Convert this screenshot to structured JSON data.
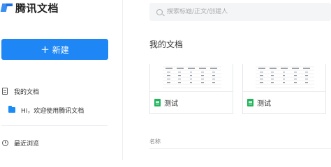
{
  "app": {
    "name": "腾讯文档"
  },
  "sidebar": {
    "new_button_label": "新建",
    "items": [
      {
        "label": "我的文档"
      },
      {
        "label": "Hi，欢迎使用腾讯文档"
      },
      {
        "label": "最近浏览"
      }
    ]
  },
  "search": {
    "placeholder": "搜索标题/正文/创建人"
  },
  "main": {
    "section_title": "我的文档",
    "cards": [
      {
        "label": "测试"
      },
      {
        "label": "测试"
      }
    ],
    "list_header": {
      "name": "名称"
    }
  },
  "colors": {
    "accent": "#1f87f5",
    "sheet": "#20b45c",
    "folder": "#1b8cf3"
  },
  "icons": [
    "logo-icon",
    "plus-icon",
    "document-icon",
    "folder-icon",
    "clock-icon",
    "search-icon",
    "sheet-icon"
  ]
}
